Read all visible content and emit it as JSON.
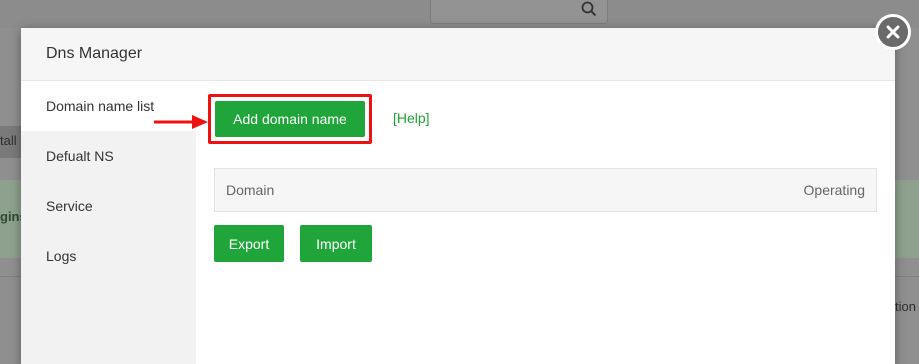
{
  "background": {
    "left_fragment_1": "tall",
    "left_fragment_2": "gins",
    "right_fragment": "tion"
  },
  "modal": {
    "title": "Dns Manager",
    "sidebar": [
      {
        "label": "Domain name list",
        "active": true
      },
      {
        "label": "Defualt NS",
        "active": false
      },
      {
        "label": "Service",
        "active": false
      },
      {
        "label": "Logs",
        "active": false
      }
    ],
    "add_button": "Add domain name",
    "help_link": "[Help]",
    "table_columns": [
      "Domain",
      "Operating"
    ],
    "export_button": "Export",
    "import_button": "Import"
  },
  "colors": {
    "accent_green": "#20a53a",
    "highlight_red": "#ee1111"
  },
  "icons": {
    "close": "close-icon",
    "search": "search-icon",
    "arrow": "red-arrow-annotation"
  }
}
